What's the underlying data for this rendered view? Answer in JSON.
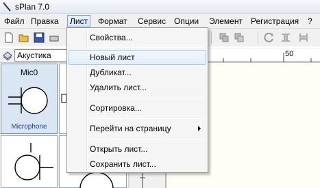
{
  "window": {
    "title": "sPlan 7.0"
  },
  "menubar": {
    "items": [
      {
        "label": "Файл"
      },
      {
        "label": "Правка"
      },
      {
        "label": "Лист"
      },
      {
        "label": "Формат"
      },
      {
        "label": "Сервис"
      },
      {
        "label": "Опции"
      },
      {
        "label": "Элемент"
      },
      {
        "label": "Регистрация"
      },
      {
        "label": "?"
      }
    ],
    "active_index": 2
  },
  "toolbar": {
    "buttons": [
      "new-icon",
      "open-icon",
      "save-icon",
      "print-icon",
      "copy-icon",
      "paste-icon",
      "rotate-icon",
      "mirror-icon",
      "mirror-vertical-icon"
    ]
  },
  "library": {
    "selected": "Акустика",
    "cells": [
      {
        "name": "Mic0",
        "caption": "Microphone"
      }
    ]
  },
  "ruler": {
    "top_label": "50",
    "left_label": "50"
  },
  "sheet_menu": {
    "items": [
      {
        "label": "Свойства..."
      },
      {
        "label": "Новый лист"
      },
      {
        "label": "Дубликат..."
      },
      {
        "label": "Удалить лист..."
      },
      {
        "label": "Сортировка..."
      },
      {
        "label": "Перейти на страницу"
      },
      {
        "label": "Открыть лист..."
      },
      {
        "label": "Сохранить лист..."
      }
    ]
  },
  "colors": {
    "menu_highlight": "#d5e6fa",
    "canvas": "#fefef6",
    "caption": "#1a3aa8"
  }
}
